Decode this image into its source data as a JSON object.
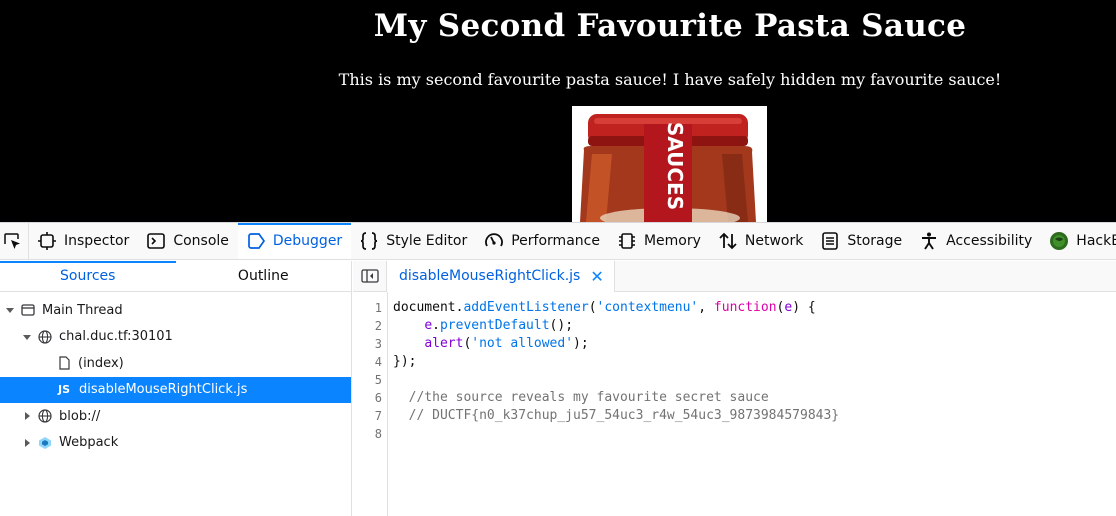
{
  "page": {
    "title": "My Second Favourite Pasta Sauce",
    "text": "This is my second favourite pasta sauce! I have safely hidden my favourite sauce!",
    "jar_label": "SAUCES"
  },
  "devtools": {
    "tools": [
      {
        "name": "Inspector",
        "icon": "inspector-icon"
      },
      {
        "name": "Console",
        "icon": "console-icon"
      },
      {
        "name": "Debugger",
        "icon": "debugger-icon",
        "selected": true
      },
      {
        "name": "Style Editor",
        "icon": "style-editor-icon"
      },
      {
        "name": "Performance",
        "icon": "performance-icon"
      },
      {
        "name": "Memory",
        "icon": "memory-icon"
      },
      {
        "name": "Network",
        "icon": "network-icon"
      },
      {
        "name": "Storage",
        "icon": "storage-icon"
      },
      {
        "name": "Accessibility",
        "icon": "accessibility-icon"
      },
      {
        "name": "HackBar",
        "icon": "hackbar-icon"
      }
    ],
    "left_tabs": {
      "sources": "Sources",
      "outline": "Outline"
    },
    "tree": {
      "main_thread": "Main Thread",
      "host": "chal.duc.tf:30101",
      "index": "(index)",
      "file_badge": "JS",
      "file": "disableMouseRightClick.js",
      "blob": "blob://",
      "webpack": "Webpack"
    },
    "editor": {
      "tab": "disableMouseRightClick.js",
      "tab_close": "✕",
      "line_numbers": [
        "1",
        "2",
        "3",
        "4",
        "5",
        "6",
        "7",
        "8"
      ],
      "code": {
        "l1_obj": "document",
        "l1_dot": ".",
        "l1_method": "addEventListener",
        "l1_open": "(",
        "l1_str": "'contextmenu'",
        "l1_comma": ", ",
        "l1_kw": "function",
        "l1_paren": "(",
        "l1_arg": "e",
        "l1_end": ") {",
        "l2_indent": "    ",
        "l2_obj": "e",
        "l2_dot": ".",
        "l2_method": "preventDefault",
        "l2_end": "();",
        "l3_indent": "    ",
        "l3_fn": "alert",
        "l3_open": "(",
        "l3_str": "'not allowed'",
        "l3_end": ");",
        "l4": "});",
        "l6": "  //the source reveals my favourite secret sauce",
        "l7": "  // DUCTF{n0_k37chup_ju57_54uc3_r4w_54uc3_9873984579843}"
      }
    }
  }
}
